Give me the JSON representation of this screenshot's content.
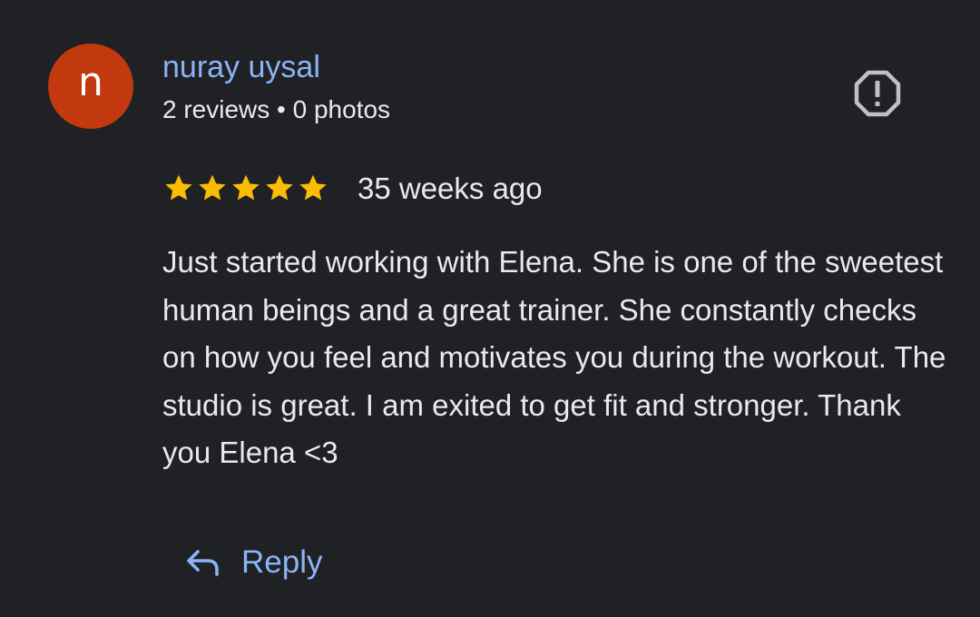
{
  "review": {
    "avatar_letter": "n",
    "reviewer_name": "nuray uysal",
    "reviewer_meta": "2 reviews • 0 photos",
    "rating": 5,
    "rating_max": 5,
    "timestamp": "35 weeks ago",
    "text": "Just started working with Elena. She is one of the sweetest human beings and a great trainer. She constantly checks on how you feel and motivates you during the workout. The studio is great. I am exited to get fit and stronger. Thank you Elena <3"
  },
  "actions": {
    "reply_label": "Reply",
    "reply_icon": "reply-arrow-icon",
    "report_icon": "report-octagon-icon"
  },
  "colors": {
    "background": "#202124",
    "avatar": "#c2390f",
    "name_link": "#8ab4f8",
    "star": "#fbbc04",
    "icon_grey": "#bdc1c6",
    "text": "#e8eaed"
  }
}
